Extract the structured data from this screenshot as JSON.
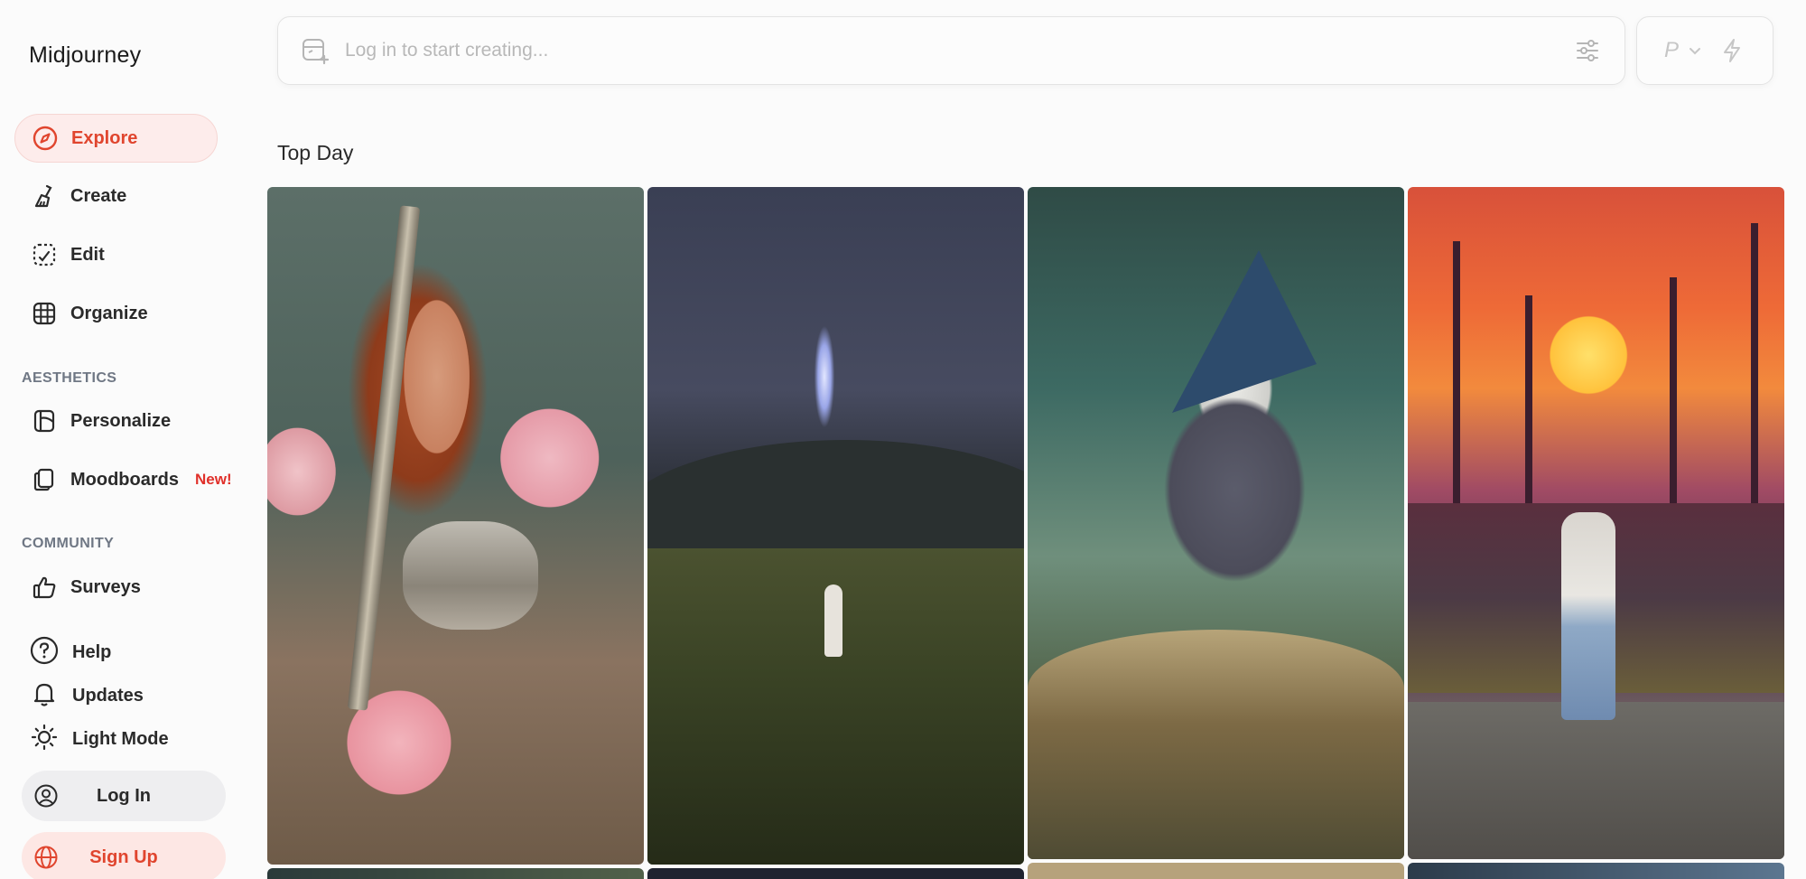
{
  "app": {
    "title": "Midjourney"
  },
  "sidebar": {
    "nav": [
      {
        "label": "Explore",
        "icon": "compass-icon",
        "active": true
      },
      {
        "label": "Create",
        "icon": "brush-icon"
      },
      {
        "label": "Edit",
        "icon": "edit-frame-icon"
      },
      {
        "label": "Organize",
        "icon": "grid-icon"
      }
    ],
    "aesthetics_heading": "AESTHETICS",
    "aesthetics": [
      {
        "label": "Personalize",
        "icon": "personalize-icon"
      },
      {
        "label": "Moodboards",
        "icon": "moodboards-icon",
        "badge": "New!"
      }
    ],
    "community_heading": "COMMUNITY",
    "community": [
      {
        "label": "Surveys",
        "icon": "thumbs-up-icon"
      }
    ],
    "utility": [
      {
        "label": "Help",
        "icon": "help-icon"
      },
      {
        "label": "Updates",
        "icon": "bell-icon"
      },
      {
        "label": "Light Mode",
        "icon": "sun-icon"
      }
    ],
    "login_label": "Log In",
    "signup_label": "Sign Up"
  },
  "prompt": {
    "placeholder": "Log in to start creating...",
    "mode_letter": "P"
  },
  "feed": {
    "title": "Top Day",
    "images": [
      "red-haired woman with peonies and sword",
      "figure walking on hillside beneath light beam",
      "wizard smoking pipe on mushroom",
      "pixel art man walking past graffiti at sunset"
    ]
  },
  "colors": {
    "accent": "#e0452e",
    "active_bg": "#fdeceb",
    "badge_new": "#e0302a",
    "login_bg": "#eeeef0",
    "signup_bg": "#fde7e4"
  }
}
